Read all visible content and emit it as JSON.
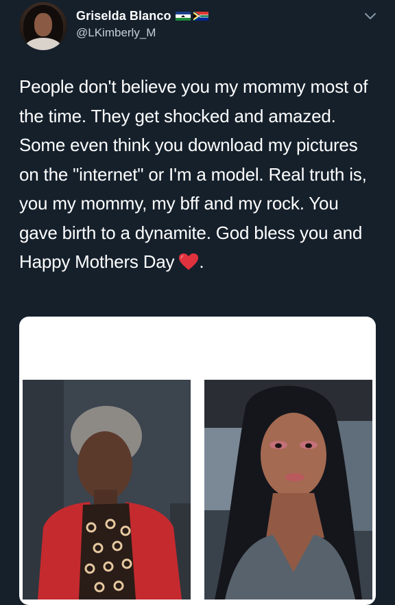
{
  "user": {
    "display_name": "Griselda Blanco",
    "handle": "@LKimberly_M",
    "avatar_icon": "profile-avatar",
    "flags": [
      "lesotho-flag-icon",
      "south-africa-flag-icon"
    ]
  },
  "tweet": {
    "text": "People don't believe you my mommy most of the time. They get shocked and amazed. Some even think you download my pictures on the \"internet\" or I'm a model. Real truth is, you my mommy, my bff and my rock. You gave birth to a dynamite. God bless you and Happy Mothers Day",
    "trailing_emoji": "red-heart-icon",
    "trailing_text": "."
  },
  "media": {
    "photos": [
      {
        "name": "photo-mother",
        "icon": "portrait-photo"
      },
      {
        "name": "photo-daughter",
        "icon": "selfie-photo"
      }
    ]
  },
  "colors": {
    "background": "#15202b",
    "text": "#ffffff",
    "secondary_text": "#c7d0d9",
    "heart": "#e0323e"
  }
}
